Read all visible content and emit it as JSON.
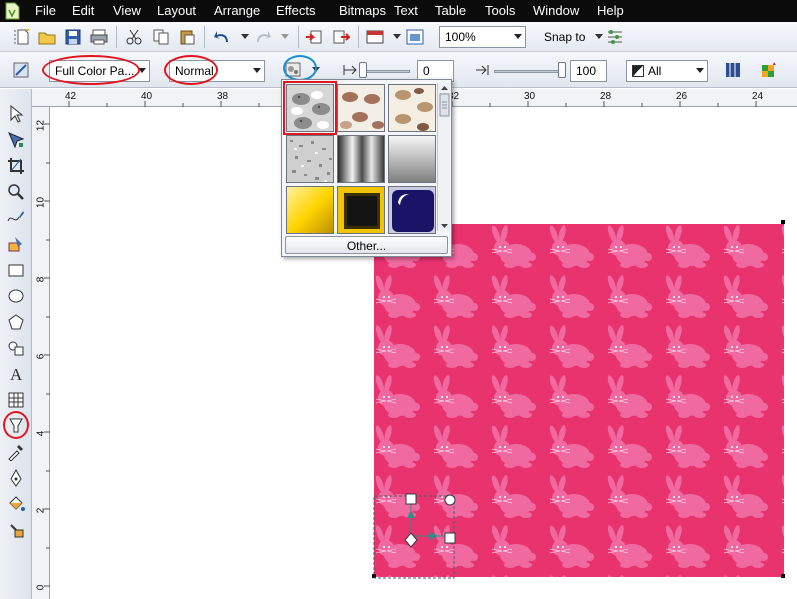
{
  "menu": [
    "File",
    "Edit",
    "View",
    "Layout",
    "Arrange",
    "Effects",
    "Bitmaps",
    "Text",
    "Table",
    "Tools",
    "Window",
    "Help"
  ],
  "toolbar1": {
    "zoom_value": "100%",
    "snap_label": "Snap to"
  },
  "property_bar": {
    "fill_type": "Full Color Pa...",
    "merge_mode": "Normal",
    "transparency_value": "0",
    "transparency_end": "100",
    "target_value": "All"
  },
  "ruler_h": [
    "42",
    "40",
    "38",
    "32",
    "30",
    "28",
    "26",
    "24"
  ],
  "ruler_v": [
    "12",
    "10",
    "8",
    "6",
    "4",
    "2",
    "0"
  ],
  "pattern_picker": {
    "other_label": "Other...",
    "swatches": [
      "bunnies-gray",
      "bunnies-brown-1",
      "bunnies-brown-2",
      "noise-gray",
      "metal-cylinder",
      "silver-gradient",
      "gold-square",
      "gold-black-frame",
      "navy-glossy"
    ]
  },
  "colors": {
    "menubar_bg": "#0b0b0b",
    "pattern_bg": "#e9336e",
    "pattern_shape": "#f06aa0",
    "annotation_red": "#e0171f",
    "annotation_blue": "#1a8fd6"
  }
}
